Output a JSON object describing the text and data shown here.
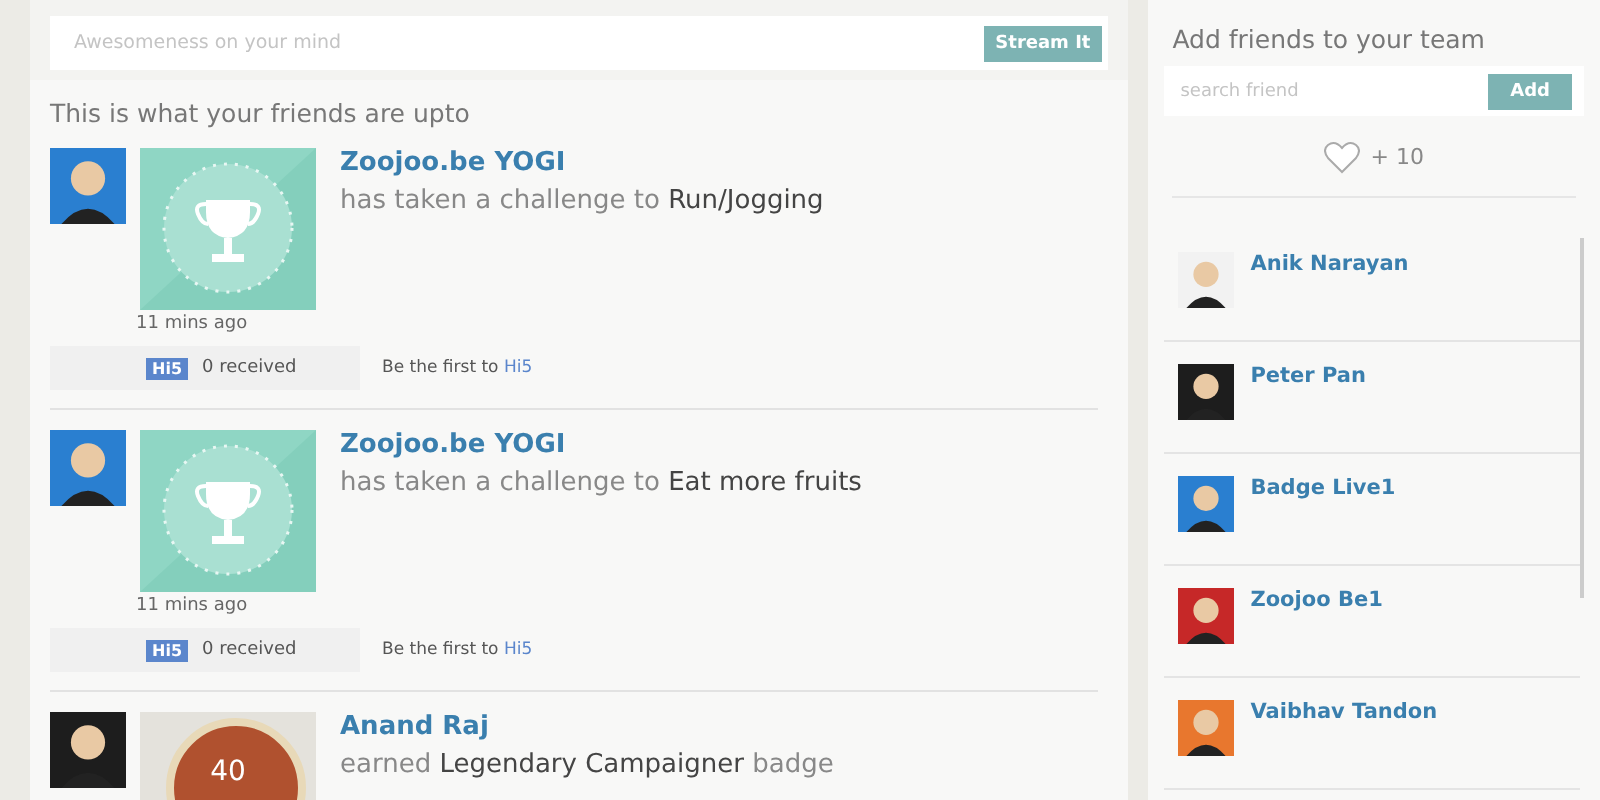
{
  "composer": {
    "placeholder": "Awesomeness on your mind",
    "button": "Stream It"
  },
  "feed": {
    "heading": "This is what your friends are upto",
    "items": [
      {
        "kind": "challenge",
        "user": "Zoojoo.be YOGI",
        "action": "has taken a challenge to **Run/Jogging**",
        "time": "11 mins ago",
        "hi5": "Hi5",
        "received": "0 received",
        "cta": "Be the first to",
        "cta_link": "Hi5"
      },
      {
        "kind": "challenge",
        "user": "Zoojoo.be YOGI",
        "action": "has taken a challenge to **Eat more fruits**",
        "time": "11 mins ago",
        "hi5": "Hi5",
        "received": "0 received",
        "cta": "Be the first to",
        "cta_link": "Hi5"
      },
      {
        "kind": "badge",
        "user": "Anand Raj",
        "action": "earned **Legendary Campaigner** badge",
        "badge_value": "40"
      }
    ]
  },
  "team": {
    "title": "Add friends to your team",
    "search_placeholder": "search friend",
    "add_button": "Add",
    "likes": "+ 10",
    "friends": [
      {
        "name": "Anik Narayan"
      },
      {
        "name": "Peter Pan"
      },
      {
        "name": "Badge Live1"
      },
      {
        "name": "Zoojoo Be1"
      },
      {
        "name": "Vaibhav Tandon"
      }
    ]
  }
}
